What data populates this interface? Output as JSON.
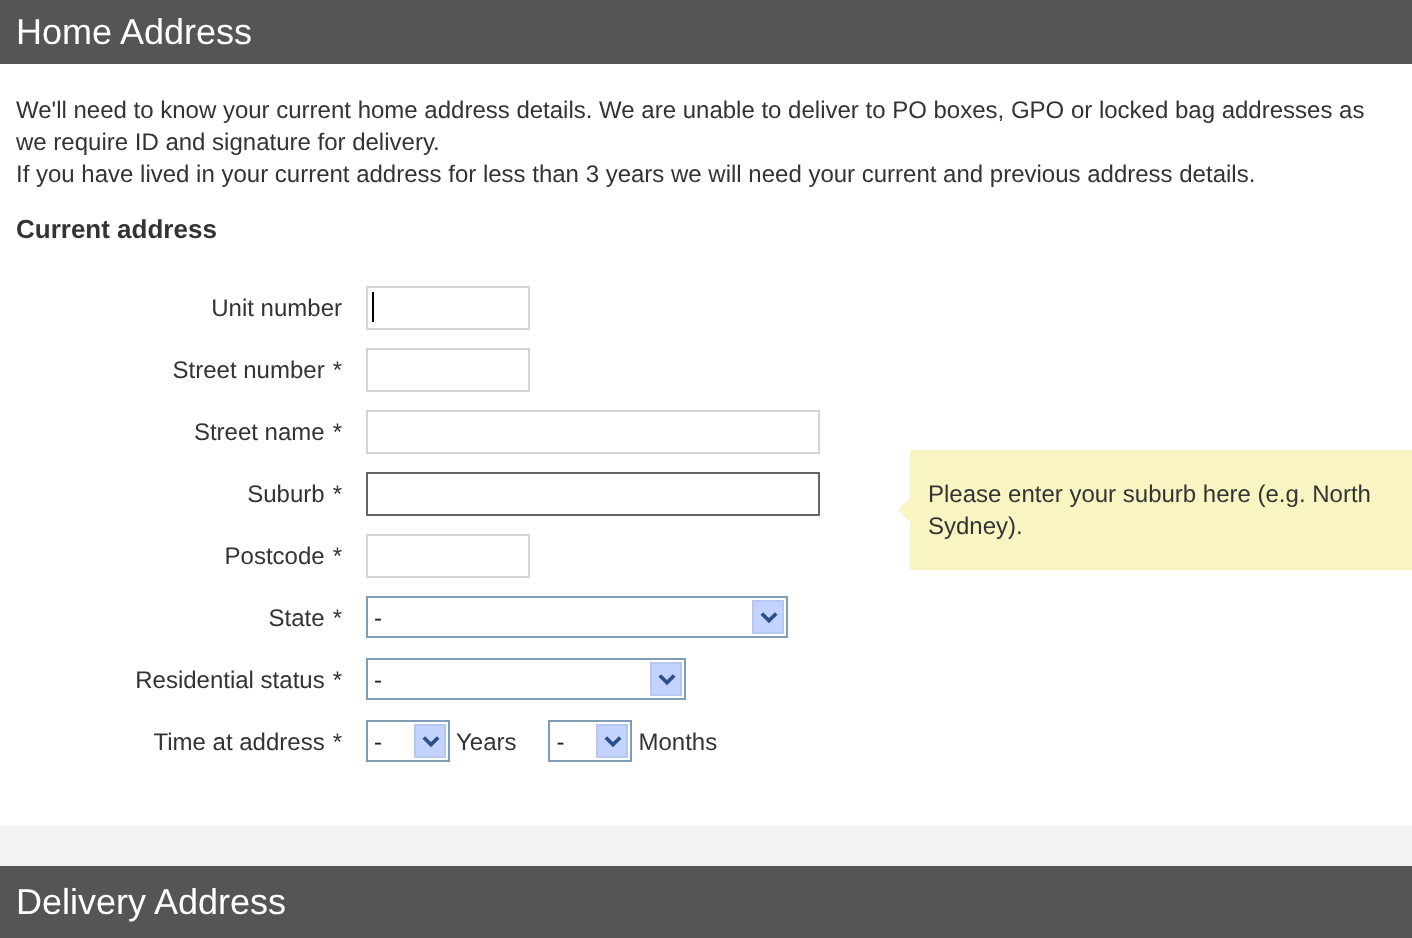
{
  "header": {
    "title": "Home Address"
  },
  "intro": [
    "We'll need to know your current home address details. We are unable to deliver to PO boxes, GPO or locked bag addresses as we require ID and signature for delivery.",
    "If you have lived in your current address for less than 3 years we will need your current and previous address details."
  ],
  "section_title": "Current address",
  "fields": [
    {
      "kind": "short",
      "label": "Unit number",
      "required": false,
      "active": false,
      "caret": true
    },
    {
      "kind": "short",
      "label": "Street number",
      "required": true,
      "active": false,
      "caret": false
    },
    {
      "kind": "long",
      "label": "Street name",
      "required": true,
      "active": false,
      "caret": false
    },
    {
      "kind": "long",
      "label": "Suburb",
      "required": true,
      "active": true,
      "caret": false
    },
    {
      "kind": "short",
      "label": "Postcode",
      "required": true,
      "active": false,
      "caret": false
    },
    {
      "kind": "wideselect",
      "label": "State",
      "required": true,
      "value": "-"
    },
    {
      "kind": "select",
      "label": "Residential status",
      "required": true,
      "value": "-"
    },
    {
      "kind": "duration",
      "label": "Time at address",
      "required": true,
      "parts": [
        {
          "value": "-",
          "unit": "Years"
        },
        {
          "value": "-",
          "unit": "Months"
        }
      ]
    }
  ],
  "required_mark": "*",
  "tooltip": "Please enter your suburb here (e.g. North Sydney).",
  "next_header": {
    "title": "Delivery Address"
  }
}
